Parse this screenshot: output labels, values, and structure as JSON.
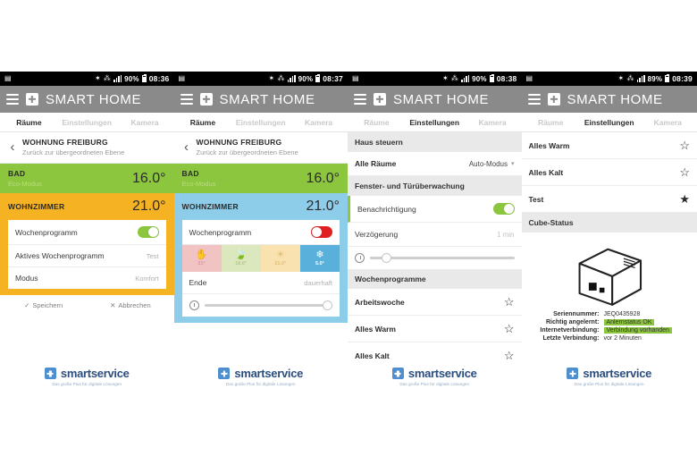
{
  "app": {
    "brand": "SMART HOME",
    "tabs": [
      "Räume",
      "Einstellungen",
      "Kamera"
    ],
    "menu_icon": "hamburger-icon",
    "brand_icon": "plus-square-icon"
  },
  "footer": {
    "name": "smartservice",
    "tagline": "Das große Plus für digitale Lösungen",
    "icon": "plus-square-icon"
  },
  "panels": [
    {
      "id": "panel-1",
      "statusbar": {
        "battery": "90%",
        "time": "08:36",
        "icons": [
          "screenshot-icon",
          "bluetooth-icon",
          "wifi-icon",
          "signal-icon",
          "battery-icon"
        ]
      },
      "active_tab": "Räume",
      "back": {
        "title": "WOHNUNG FREIBURG",
        "subtitle": "Zurück zur übergeordneten Ebene",
        "icon": "chevron-left-icon"
      },
      "rooms": [
        {
          "name": "BAD",
          "sub": "Eco-Modus",
          "temp": "16.0°",
          "color": "#8cc63f"
        },
        {
          "name": "WOHNZIMMER",
          "sub": "",
          "temp": "21.0°",
          "color": "#f5b324"
        }
      ],
      "card_rows": [
        {
          "label": "Wochenprogramm",
          "value": "",
          "control": "toggle-on"
        },
        {
          "label": "Aktives Wochenprogramm",
          "value": "Test",
          "control": "text"
        },
        {
          "label": "Modus",
          "value": "Komfort",
          "control": "text"
        }
      ],
      "actions": [
        {
          "label": "Speichern",
          "glyph": "✓",
          "icon": "check-icon"
        },
        {
          "label": "Abbrechen",
          "glyph": "✕",
          "icon": "cross-icon"
        }
      ]
    },
    {
      "id": "panel-2",
      "statusbar": {
        "battery": "90%",
        "time": "08:37",
        "icons": [
          "screenshot-icon",
          "bluetooth-icon",
          "wifi-icon",
          "signal-icon",
          "battery-icon"
        ]
      },
      "active_tab": "Räume",
      "back": {
        "title": "WOHNUNG FREIBURG",
        "subtitle": "Zurück zur übergeordneten Ebene",
        "icon": "chevron-left-icon"
      },
      "rooms": [
        {
          "name": "BAD",
          "sub": "Eco-Modus",
          "temp": "16.0°",
          "color": "#8cc63f"
        },
        {
          "name": "WOHNZIMMER",
          "sub": "",
          "temp": "21.0°",
          "color": "#8ecdea"
        }
      ],
      "toggle_row": {
        "label": "Wochenprogramm",
        "control": "toggle-off"
      },
      "modes": [
        {
          "glyph": "✋",
          "value": "21°",
          "icon": "hand-icon",
          "name": "manuell"
        },
        {
          "glyph": "🍃",
          "value": "16.0°",
          "icon": "leaf-icon",
          "name": "eco"
        },
        {
          "glyph": "☀",
          "value": "21.0°",
          "icon": "sun-icon",
          "name": "komfort"
        },
        {
          "glyph": "❄",
          "value": "5.0°",
          "icon": "snowflake-icon",
          "name": "frostschutz"
        }
      ],
      "end_row": {
        "label": "Ende",
        "value": "dauerhaft"
      },
      "slider": {
        "icon": "clock-icon",
        "position": 100
      }
    },
    {
      "id": "panel-3",
      "statusbar": {
        "battery": "90%",
        "time": "08:38",
        "icons": [
          "screenshot-icon",
          "bluetooth-icon",
          "wifi-icon",
          "signal-icon",
          "battery-icon"
        ]
      },
      "active_tab": "Einstellungen",
      "sections": [
        {
          "type": "header",
          "label": "Haus steuern"
        },
        {
          "type": "select",
          "label": "Alle Räume",
          "value": "Auto-Modus",
          "icon": "caret-down-icon"
        },
        {
          "type": "header",
          "label": "Fenster- und Türüberwachung"
        },
        {
          "type": "toggle",
          "label": "Benachrichtigung",
          "control": "toggle-on"
        },
        {
          "type": "value",
          "label": "Verzögerung",
          "value": "1 min"
        },
        {
          "type": "slider",
          "icon": "clock-icon",
          "position": 8
        },
        {
          "type": "header",
          "label": "Wochenprogramme"
        },
        {
          "type": "star",
          "label": "Arbeitswoche",
          "starred": false
        },
        {
          "type": "star",
          "label": "Alles Warm",
          "starred": false
        },
        {
          "type": "star",
          "label": "Alles Kalt",
          "starred": false
        }
      ]
    },
    {
      "id": "panel-4",
      "statusbar": {
        "battery": "89%",
        "time": "08:39",
        "icons": [
          "screenshot-icon",
          "bluetooth-icon",
          "wifi-icon",
          "signal-icon",
          "battery-icon"
        ]
      },
      "active_tab": "Einstellungen",
      "program_rows": [
        {
          "label": "Alles Warm",
          "starred": false
        },
        {
          "label": "Alles Kalt",
          "starred": false
        },
        {
          "label": "Test",
          "starred": true
        }
      ],
      "cube": {
        "section_label": "Cube-Status",
        "icon": "cube-icon",
        "fields": [
          {
            "key": "Seriennummer:",
            "value": "JEQ0435928",
            "highlight": false
          },
          {
            "key": "Richtig angelernt:",
            "value": "Anlernstatus OK",
            "highlight": true
          },
          {
            "key": "Internetverbindung:",
            "value": "Verbindung vorhanden",
            "highlight": true
          },
          {
            "key": "Letzte Verbindung:",
            "value": "vor 2 Minuten",
            "highlight": false
          }
        ]
      }
    }
  ]
}
